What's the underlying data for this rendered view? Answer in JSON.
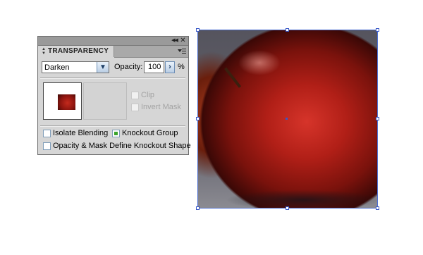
{
  "panel": {
    "title": "TRANSPARENCY",
    "collapse_icon": "double-chevron-left",
    "close_icon": "close-x",
    "menu_icon": "panel-menu",
    "blend_mode": "Darken",
    "opacity_label": "Opacity:",
    "opacity_value": "100",
    "percent_sign": "%",
    "options": {
      "clip": {
        "label": "Clip",
        "checked": false,
        "enabled": false
      },
      "invert_mask": {
        "label": "Invert Mask",
        "checked": false,
        "enabled": false
      },
      "isolate_blending": {
        "label": "Isolate Blending",
        "checked": false,
        "enabled": true
      },
      "knockout_group": {
        "label": "Knockout Group",
        "checked": true,
        "enabled": true
      },
      "opacity_mask_knockout": {
        "label": "Opacity & Mask Define Knockout Shape",
        "checked": false,
        "enabled": true
      }
    }
  },
  "artwork": {
    "subject": "red apple with water droplets",
    "selection_color": "#4d6fd1"
  }
}
